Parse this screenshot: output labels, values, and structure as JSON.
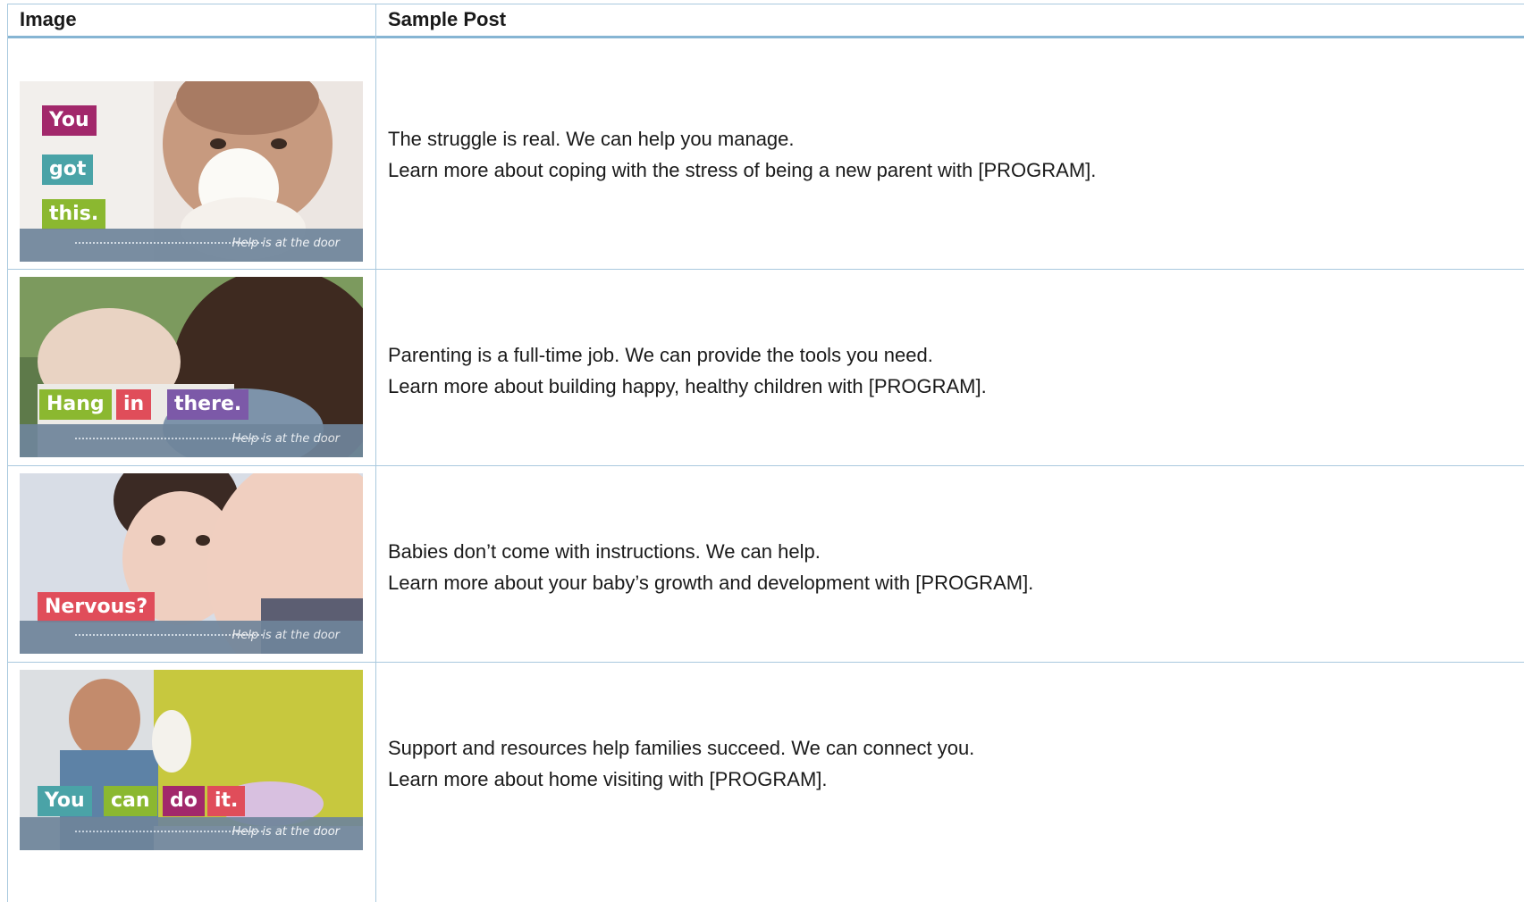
{
  "table": {
    "headers": [
      "Image",
      "Sample Post"
    ]
  },
  "rows": [
    {
      "thumbnail": {
        "words": [
          "You",
          "got",
          "this."
        ],
        "tagline": "Help is at the door",
        "word_colors": [
          "#a2286b",
          "#4aa3a7",
          "#8bb830"
        ]
      },
      "post_lines": [
        "The struggle is real. We can help you manage.",
        "Learn more about coping with the stress of being a new parent with [PROGRAM]."
      ]
    },
    {
      "thumbnail": {
        "words": [
          "Hang",
          "in",
          "there."
        ],
        "tagline": "Help is at the door",
        "word_colors": [
          "#8bb830",
          "#e04d5a",
          "#7c59a8"
        ]
      },
      "post_lines": [
        "Parenting is a full-time job. We can provide the tools you need.",
        "Learn more about building happy, healthy children with [PROGRAM]."
      ]
    },
    {
      "thumbnail": {
        "words": [
          "Nervous?"
        ],
        "tagline": "Help is at the door",
        "word_colors": [
          "#e04d5a"
        ]
      },
      "post_lines": [
        "Babies don’t come with instructions. We can help.",
        "Learn more about your baby’s growth and development with [PROGRAM]."
      ]
    },
    {
      "thumbnail": {
        "words": [
          "You",
          "can",
          "do",
          "it."
        ],
        "tagline": "Help is at the door",
        "word_colors": [
          "#4aa3a7",
          "#8bb830",
          "#a2286b",
          "#e04d5a"
        ]
      },
      "post_lines": [
        "Support and resources help families succeed. We can connect you.",
        "Learn more about home visiting with [PROGRAM]."
      ]
    }
  ]
}
